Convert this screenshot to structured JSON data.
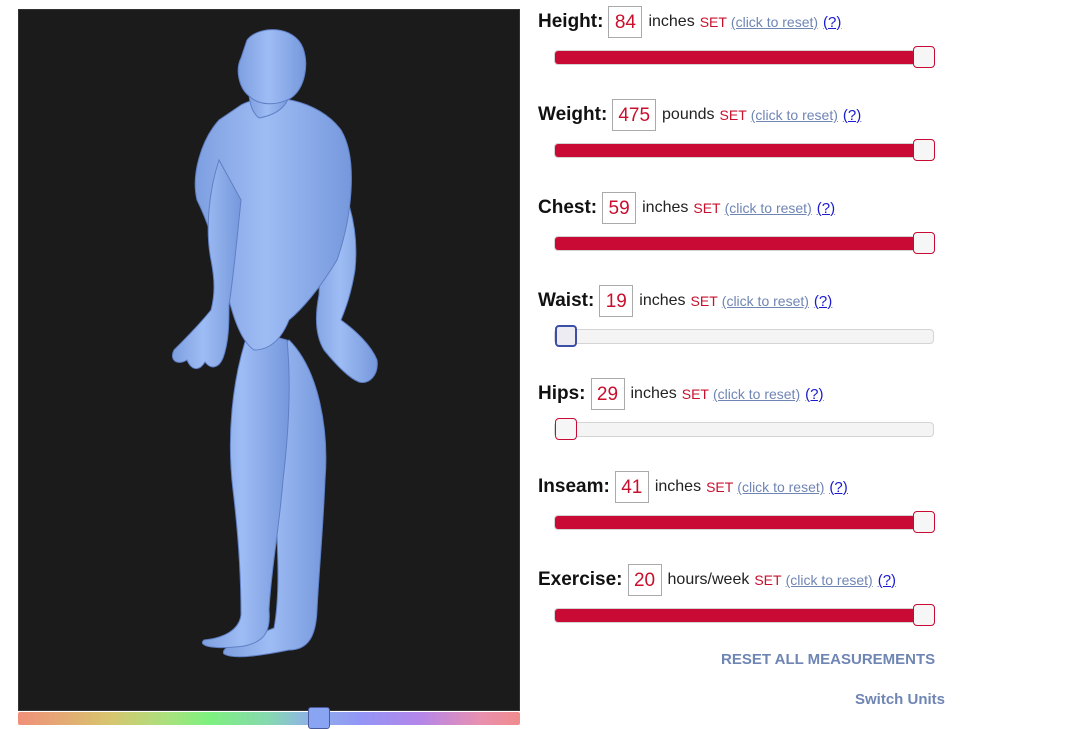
{
  "controls": [
    {
      "key": "height",
      "label": "Height:",
      "value": "84",
      "unit": "inches",
      "set": "SET",
      "reset": "(click to reset)",
      "help": "(?)",
      "level": 1.0,
      "focused": false
    },
    {
      "key": "weight",
      "label": "Weight:",
      "value": "475",
      "unit": "pounds",
      "set": "SET",
      "reset": "(click to reset)",
      "help": "(?)",
      "level": 1.0,
      "focused": false
    },
    {
      "key": "chest",
      "label": "Chest:",
      "value": "59",
      "unit": "inches",
      "set": "SET",
      "reset": "(click to reset)",
      "help": "(?)",
      "level": 1.0,
      "focused": false
    },
    {
      "key": "waist",
      "label": "Waist:",
      "value": "19",
      "unit": "inches",
      "set": "SET",
      "reset": "(click to reset)",
      "help": "(?)",
      "level": 0.0,
      "focused": true
    },
    {
      "key": "hips",
      "label": "Hips:",
      "value": "29",
      "unit": "inches",
      "set": "SET",
      "reset": "(click to reset)",
      "help": "(?)",
      "level": 0.0,
      "focused": false
    },
    {
      "key": "inseam",
      "label": "Inseam:",
      "value": "41",
      "unit": "inches",
      "set": "SET",
      "reset": "(click to reset)",
      "help": "(?)",
      "level": 1.0,
      "focused": false
    },
    {
      "key": "exercise",
      "label": "Exercise:",
      "value": "20",
      "unit": "hours/week",
      "set": "SET",
      "reset": "(click to reset)",
      "help": "(?)",
      "level": 1.0,
      "focused": false
    }
  ],
  "actions": {
    "reset_all": "RESET ALL MEASUREMENTS",
    "switch_units": "Switch Units"
  },
  "viewer": {
    "background": "#1b1b1b",
    "model_color": "#8fb0ec",
    "color_slider_level": 0.6
  },
  "colors": {
    "accent": "#c80a35",
    "link": "#6f85b4",
    "help_link": "#1a1ad0"
  }
}
